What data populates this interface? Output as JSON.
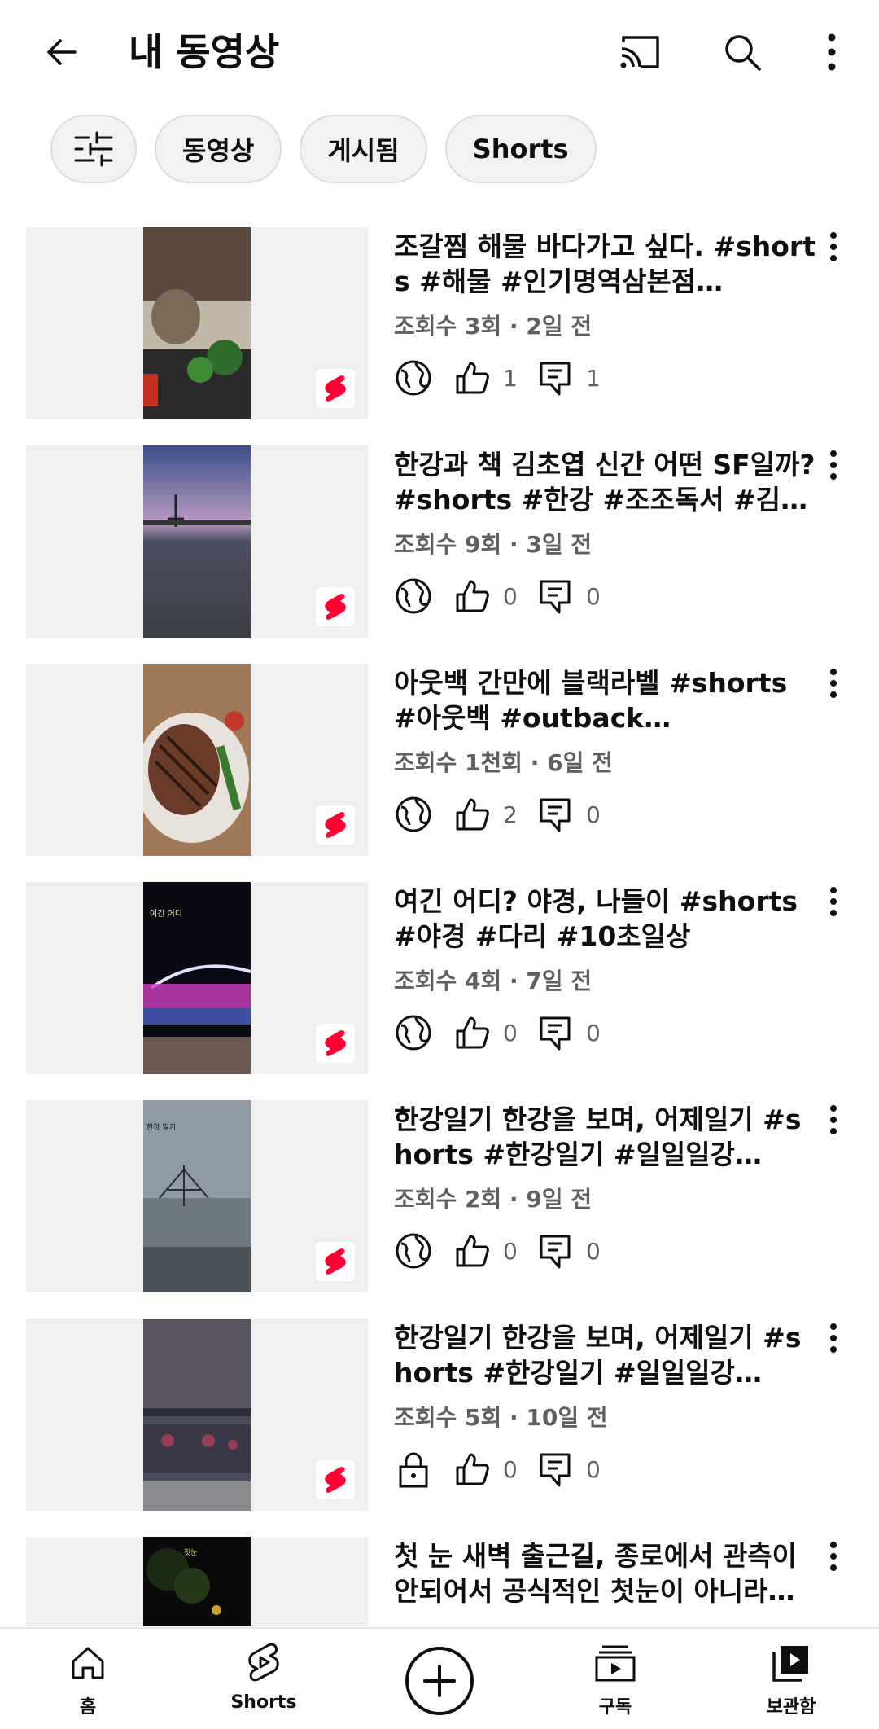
{
  "header": {
    "title": "내 동영상"
  },
  "chips": [
    "동영상",
    "게시됨",
    "Shorts"
  ],
  "videos": [
    {
      "title": "조갈찜 해물 바다가고 싶다. #shorts #해물 #인기명역삼본점…",
      "meta": "조회수 3회 · 2일 전",
      "privacy": "public",
      "likes": "1",
      "comments": "1",
      "thumb_colors": [
        "#5a4a3e",
        "#2f6b2a",
        "#c2b8a8"
      ]
    },
    {
      "title": "한강과 책 김초엽 신간 어떤 SF일까? #shorts #한강 #조조독서 #김초…",
      "meta": "조회수 9회 · 3일 전",
      "privacy": "public",
      "likes": "0",
      "comments": "0",
      "thumb_colors": [
        "#3a4f8a",
        "#b89ac0",
        "#3c4046"
      ]
    },
    {
      "title": "아웃백 간만에 블랙라벨 #shorts #아웃백 #outback…",
      "meta": "조회수 1천회 · 6일 전",
      "privacy": "public",
      "likes": "2",
      "comments": "0",
      "thumb_colors": [
        "#6b3b2a",
        "#e8e2dc",
        "#3a7a2e"
      ]
    },
    {
      "title": "여긴 어디? 야경, 나들이 #shorts #야경 #다리 #10초일상",
      "meta": "조회수 4회 · 7일 전",
      "privacy": "public",
      "likes": "0",
      "comments": "0",
      "thumb_colors": [
        "#0a0a12",
        "#d040c0",
        "#6a5a50"
      ]
    },
    {
      "title": "한강일기 한강을 보며, 어제일기 #shorts #한강일기 #일일일강…",
      "meta": "조회수 2회 · 9일 전",
      "privacy": "public",
      "likes": "0",
      "comments": "0",
      "thumb_colors": [
        "#8e9aa6",
        "#6e7a80",
        "#4a5258"
      ]
    },
    {
      "title": "한강일기 한강을 보며, 어제일기 #shorts #한강일기 #일일일강…",
      "meta": "조회수 5회 · 10일 전",
      "privacy": "private",
      "likes": "0",
      "comments": "0",
      "thumb_colors": [
        "#4a4e5a",
        "#c04060",
        "#8a8a90"
      ]
    },
    {
      "title": "첫 눈 새벽 출근길, 종로에서 관측이 안되어서 공식적인 첫눈이 아니라…",
      "meta": "",
      "privacy": "",
      "likes": "",
      "comments": "",
      "thumb_colors": [
        "#1a2a12",
        "#c8a030",
        "#0a0a0a"
      ]
    }
  ],
  "nav": [
    {
      "label": "홈",
      "icon": "home-icon"
    },
    {
      "label": "Shorts",
      "icon": "shorts-icon"
    },
    {
      "label": "",
      "icon": "create-icon"
    },
    {
      "label": "구독",
      "icon": "subscriptions-icon"
    },
    {
      "label": "보관함",
      "icon": "library-icon"
    }
  ],
  "colors": {
    "shorts_red": "#ff0033",
    "text_secondary": "#606060",
    "chip_bg": "#f2f2f2"
  }
}
